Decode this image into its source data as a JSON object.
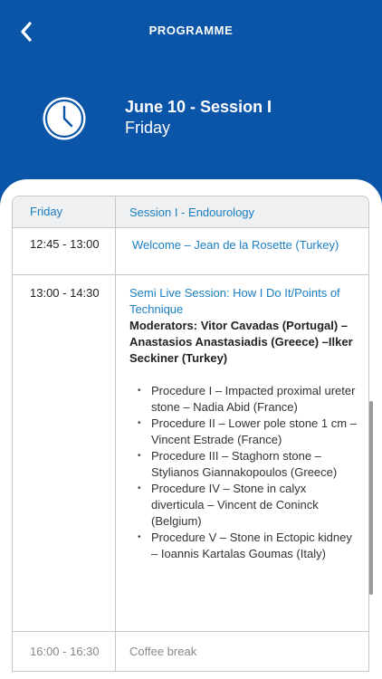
{
  "header": {
    "title": "PROGRAMME",
    "session_title": "June 10 - Session I",
    "session_day": "Friday"
  },
  "icons": {
    "back": "chevron-left-icon",
    "clock": "clock-icon"
  },
  "colors": {
    "primary": "#0a55a8",
    "link": "#1a7ec1",
    "table_header_bg": "#eef0f2"
  },
  "table": {
    "header_day": "Friday",
    "header_session": "Session I - Endourology",
    "rows": [
      {
        "time": "12:45 - 13:00",
        "title": "Welcome – Jean de la Rosette (Turkey)"
      },
      {
        "time": "13:00 - 14:30",
        "title": "Semi Live Session: How I Do It/Points of Technique",
        "moderators": "Moderators: Vitor Cavadas (Portugal) – Anastasios Anastasiadis (Greece) –Ilker Seckiner (Turkey)",
        "procedures": [
          "Procedure I – Impacted proximal ureter stone – Nadia Abid (France)",
          "Procedure II – Lower pole stone 1 cm – Vincent Estrade (France)",
          "Procedure III – Staghorn stone – Stylianos Giannakopoulos (Greece)",
          "Procedure IV – Stone in calyx diverticula – Vincent de Coninck (Belgium)",
          "Procedure V – Stone in Ectopic kidney – Ioannis Kartalas Goumas (Italy)"
        ]
      },
      {
        "time": "16:00 - 16:30",
        "title": "Coffee break"
      }
    ]
  }
}
